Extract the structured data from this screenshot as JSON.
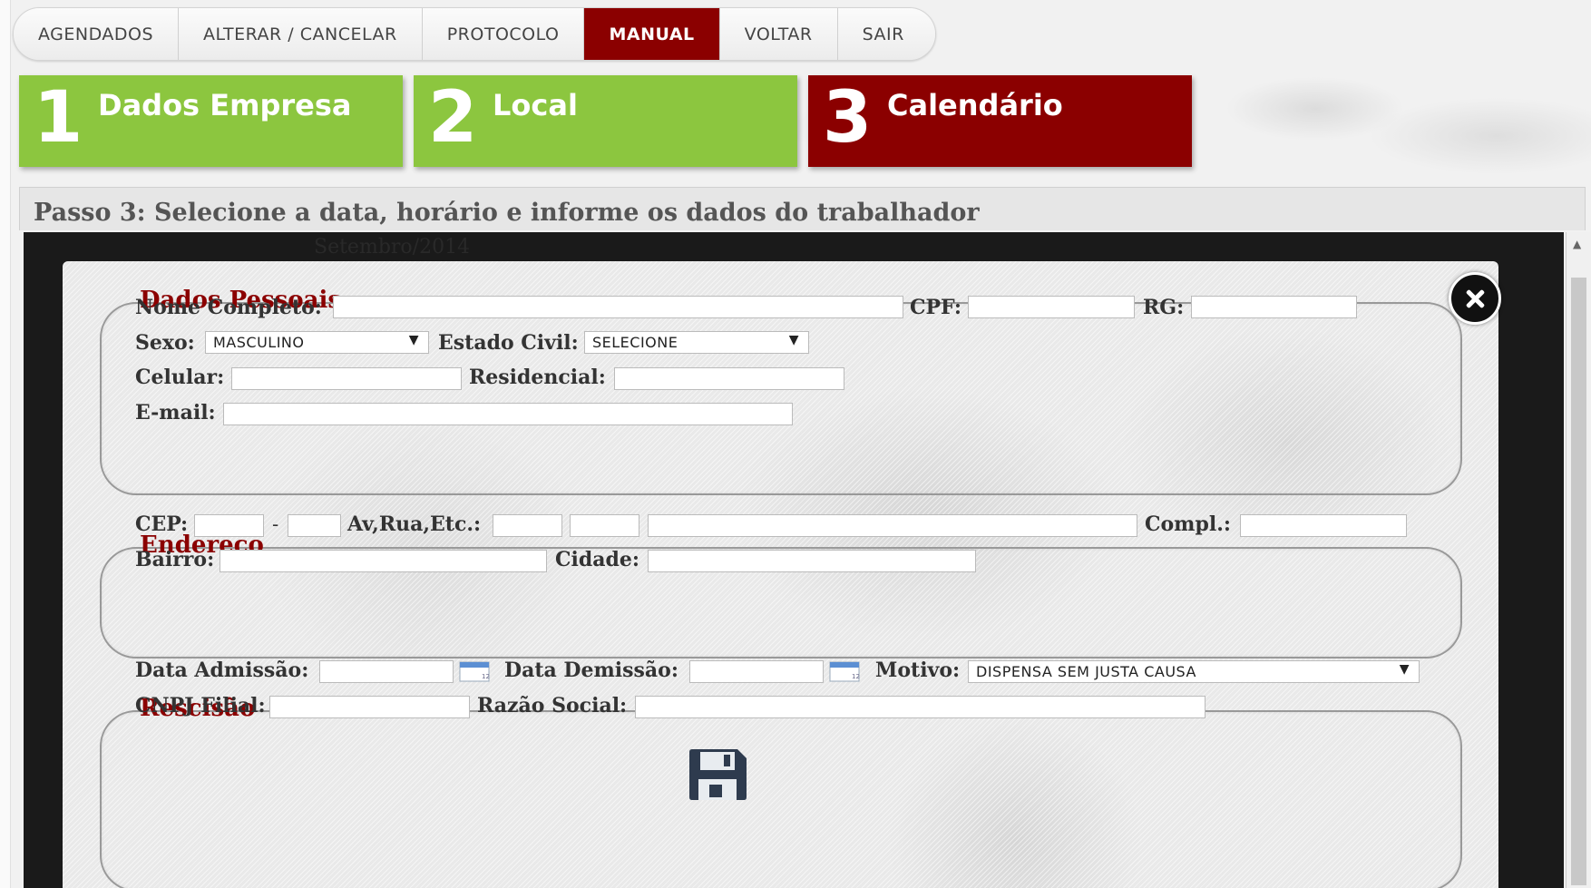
{
  "nav": {
    "items": [
      "AGENDADOS",
      "ALTERAR / CANCELAR",
      "PROTOCOLO",
      "MANUAL",
      "VOLTAR",
      "SAIR"
    ],
    "active": "MANUAL"
  },
  "steps": [
    {
      "num": "1",
      "label": "Dados Empresa",
      "active": false
    },
    {
      "num": "2",
      "label": "Local",
      "active": false
    },
    {
      "num": "3",
      "label": "Calendário",
      "active": true
    }
  ],
  "step_header": "Passo 3: Selecione a data, horário e informe os dados do trabalhador",
  "background_text": "Setembro/2014",
  "modal": {
    "dados_pessoais": {
      "legend": "Dados Pessoais",
      "nome_label": "Nome Completo:",
      "nome_value": "",
      "cpf_label": "CPF:",
      "cpf_value": "",
      "rg_label": "RG:",
      "rg_value": "",
      "sexo_label": "Sexo:",
      "sexo_value": "MASCULINO",
      "estado_civil_label": "Estado Civil:",
      "estado_civil_value": "SELECIONE",
      "celular_label": "Celular:",
      "celular_value": "",
      "residencial_label": "Residencial:",
      "residencial_value": "",
      "email_label": "E-mail:",
      "email_value": ""
    },
    "endereco": {
      "legend": "Endereço",
      "cep_label": "CEP:",
      "cep_sep": "-",
      "av_label": "Av,Rua,Etc.:",
      "compl_label": "Compl.:",
      "bairro_label": "Bairro:",
      "cidade_label": "Cidade:"
    },
    "rescisao": {
      "legend": "Rescisão",
      "admissao_label": "Data Admissão:",
      "demissao_label": "Data Demissão:",
      "motivo_label": "Motivo:",
      "motivo_value": "DISPENSA SEM JUSTA CAUSA",
      "cnpj_label": "CNPJ Filial:",
      "razao_label": "Razão Social:"
    }
  },
  "colors": {
    "accent_red": "#8b0000",
    "step_green": "#8cc63f",
    "legend_red": "#8b0000"
  },
  "icons": [
    "close-icon",
    "calendar-icon",
    "save-icon",
    "dropdown-caret-icon",
    "scroll-up-icon"
  ]
}
